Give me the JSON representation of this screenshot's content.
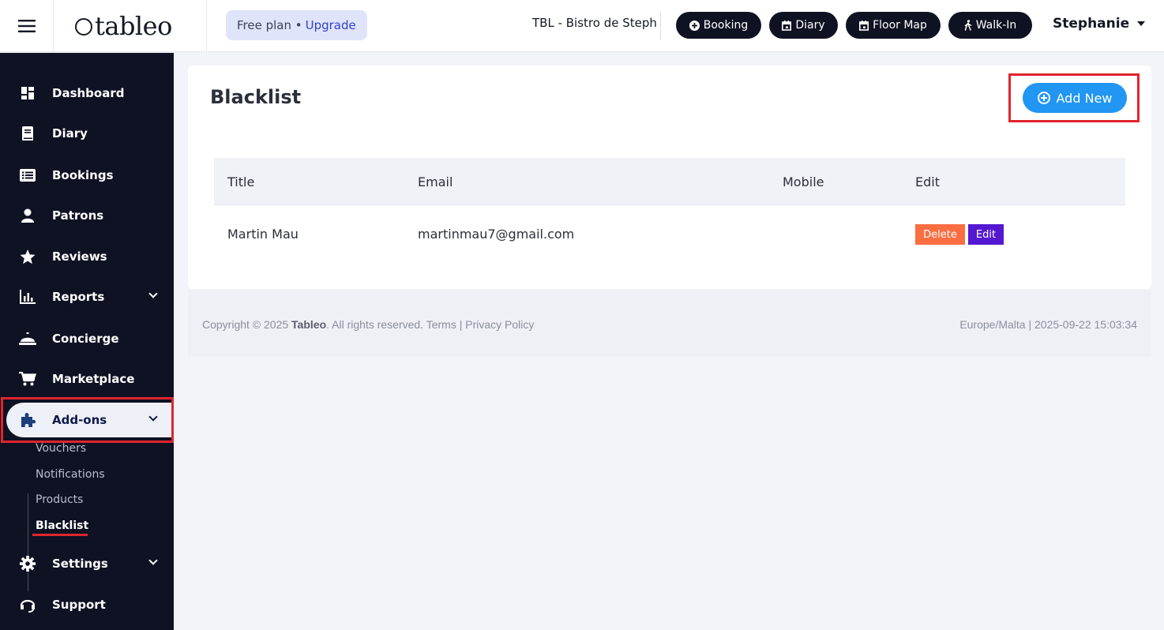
{
  "header": {
    "logo": "tableo",
    "plan_text": "Free plan •",
    "upgrade_label": "Upgrade",
    "restaurant": "TBL - Bistro de Steph",
    "quick_actions": [
      {
        "label": "Booking",
        "icon": "plus-circle-icon"
      },
      {
        "label": "Diary",
        "icon": "calendar-icon"
      },
      {
        "label": "Floor Map",
        "icon": "calendar-icon"
      },
      {
        "label": "Walk-In",
        "icon": "walking-icon"
      }
    ],
    "user": "Stephanie"
  },
  "sidebar": {
    "items": [
      {
        "label": "Dashboard",
        "icon": "dashboard-icon"
      },
      {
        "label": "Diary",
        "icon": "book-icon"
      },
      {
        "label": "Bookings",
        "icon": "list-icon"
      },
      {
        "label": "Patrons",
        "icon": "person-icon"
      },
      {
        "label": "Reviews",
        "icon": "star-icon"
      },
      {
        "label": "Reports",
        "icon": "bar-chart-icon"
      },
      {
        "label": "Concierge",
        "icon": "bell-icon"
      },
      {
        "label": "Marketplace",
        "icon": "cart-icon"
      },
      {
        "label": "Add-ons",
        "icon": "puzzle-icon"
      },
      {
        "label": "Settings",
        "icon": "gear-icon"
      },
      {
        "label": "Support",
        "icon": "headset-icon"
      }
    ],
    "addons_sub": [
      "Vouchers",
      "Notifications",
      "Products",
      "Blacklist"
    ]
  },
  "main": {
    "title": "Blacklist",
    "add_new_label": "Add New",
    "table": {
      "columns": [
        "Title",
        "Email",
        "Mobile",
        "Edit"
      ],
      "rows": [
        {
          "title": "Martin Mau",
          "email": "martinmau7@gmail.com",
          "mobile": "",
          "delete_label": "Delete",
          "edit_label": "Edit"
        }
      ]
    }
  },
  "footer": {
    "copyright": "Copyright © 2025",
    "brand": "Tableo",
    "rights": ". All rights reserved.",
    "terms": "Terms",
    "separator": "|",
    "privacy": "Privacy Policy",
    "timezone_time": "Europe/Malta | 2025-09-22 15:03:34"
  },
  "colors": {
    "sidebar_bg": "#0e1223",
    "accent_blue": "#2196f3",
    "delete_orange": "#fa6e42",
    "edit_purple": "#5518d1",
    "highlight_red": "#e0252e"
  }
}
